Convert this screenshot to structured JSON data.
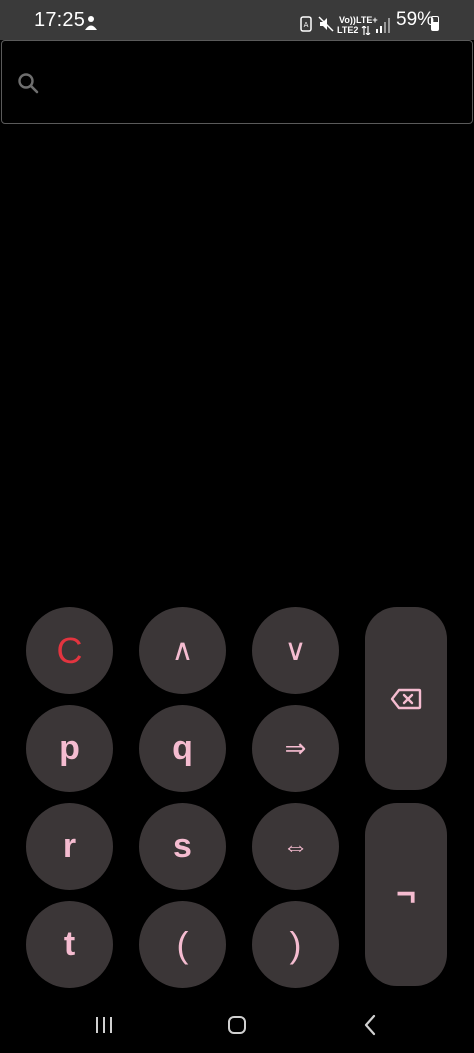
{
  "status_bar": {
    "time": "17:25",
    "battery_percent": "59%",
    "battery_level": 0.59,
    "network": {
      "volte": "Vo))",
      "lte_top": "LTE+",
      "lte_bottom": "LTE2"
    }
  },
  "search": {
    "value": "",
    "placeholder": ""
  },
  "keypad": {
    "keys": [
      {
        "label": "C",
        "role": "clear"
      },
      {
        "label": "∧",
        "role": "and"
      },
      {
        "label": "∨",
        "role": "or"
      },
      {
        "label": "p",
        "role": "var-p"
      },
      {
        "label": "q",
        "role": "var-q"
      },
      {
        "label": "⇒",
        "role": "implies"
      },
      {
        "label": "r",
        "role": "var-r"
      },
      {
        "label": "s",
        "role": "var-s"
      },
      {
        "label": "⇔",
        "role": "iff"
      },
      {
        "label": "t",
        "role": "var-t"
      },
      {
        "label": "(",
        "role": "open-paren"
      },
      {
        "label": ")",
        "role": "close-paren"
      }
    ],
    "backspace_icon": "backspace-icon",
    "not_label": "¬"
  },
  "nav": {
    "icons": [
      "recent-apps-icon",
      "home-icon",
      "back-icon"
    ]
  },
  "colors": {
    "key_bg": "#3b3637",
    "key_text": "#f5bcd0",
    "clear_text": "#e3343f",
    "status_bar_bg": "#3a3a3a",
    "background": "#000000"
  }
}
